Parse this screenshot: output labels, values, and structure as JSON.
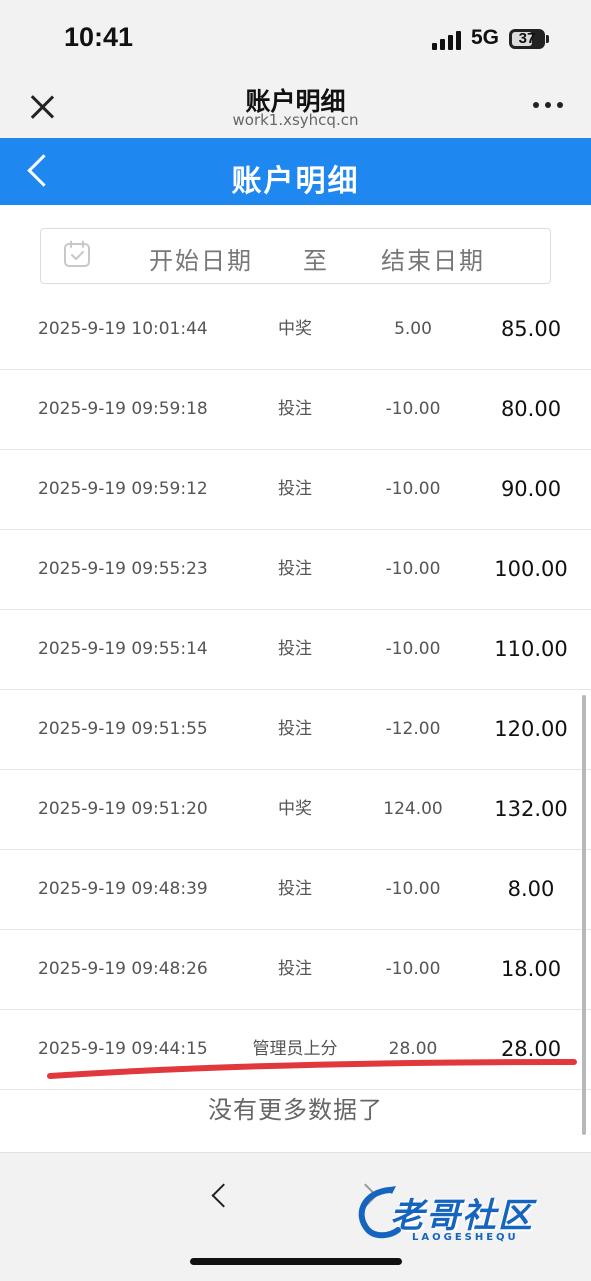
{
  "status_bar": {
    "time": "10:41",
    "network": "5G",
    "battery": "37"
  },
  "browser": {
    "title": "账户明细",
    "url": "work1.xsyhcq.cn"
  },
  "app_header": {
    "title": "账户明细"
  },
  "date_filter": {
    "start_placeholder": "开始日期",
    "separator": "至",
    "end_placeholder": "结束日期"
  },
  "records": [
    {
      "time": "2025-9-19 10:01:44",
      "type": "中奖",
      "amount": "5.00",
      "balance": "85.00"
    },
    {
      "time": "2025-9-19 09:59:18",
      "type": "投注",
      "amount": "-10.00",
      "balance": "80.00"
    },
    {
      "time": "2025-9-19 09:59:12",
      "type": "投注",
      "amount": "-10.00",
      "balance": "90.00"
    },
    {
      "time": "2025-9-19 09:55:23",
      "type": "投注",
      "amount": "-10.00",
      "balance": "100.00"
    },
    {
      "time": "2025-9-19 09:55:14",
      "type": "投注",
      "amount": "-10.00",
      "balance": "110.00"
    },
    {
      "time": "2025-9-19 09:51:55",
      "type": "投注",
      "amount": "-12.00",
      "balance": "120.00"
    },
    {
      "time": "2025-9-19 09:51:20",
      "type": "中奖",
      "amount": "124.00",
      "balance": "132.00"
    },
    {
      "time": "2025-9-19 09:48:39",
      "type": "投注",
      "amount": "-10.00",
      "balance": "8.00"
    },
    {
      "time": "2025-9-19 09:48:26",
      "type": "投注",
      "amount": "-10.00",
      "balance": "18.00"
    },
    {
      "time": "2025-9-19 09:44:15",
      "type": "管理员上分",
      "amount": "28.00",
      "balance": "28.00"
    }
  ],
  "no_more_text": "没有更多数据了",
  "watermark": {
    "text": "老哥社区",
    "sub": "LAOGESHEQU"
  },
  "colors": {
    "header_blue": "#1e88f0",
    "underline_red": "#e0383c"
  }
}
